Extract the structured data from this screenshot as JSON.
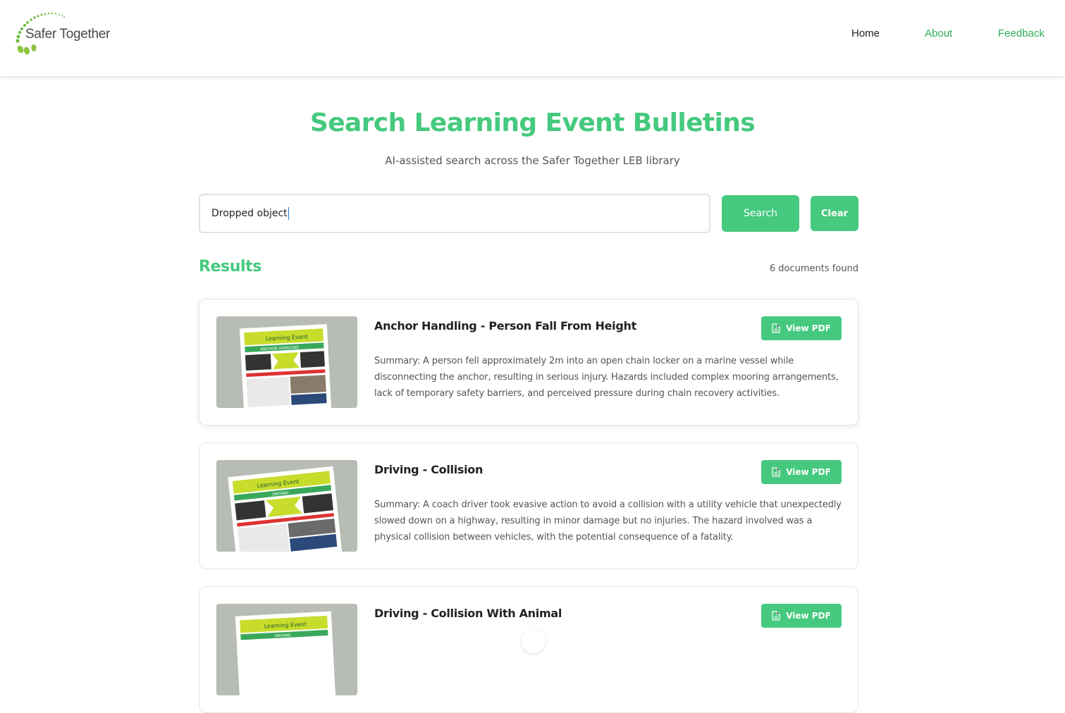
{
  "header": {
    "logo_text": "Safer Together",
    "nav": [
      {
        "label": "Home"
      },
      {
        "label": "About"
      },
      {
        "label": "Feedback"
      }
    ]
  },
  "hero": {
    "title": "Search Learning Event Bulletins",
    "subtitle": "AI-assisted search across the Safer Together LEB library"
  },
  "search": {
    "value": "Dropped object",
    "search_label": "Search",
    "clear_label": "Clear"
  },
  "results": {
    "title": "Results",
    "count_text": "6 documents found",
    "items": [
      {
        "title": "Anchor Handling - Person Fall From Height",
        "summary": "Summary: A person fell approximately 2m into an open chain locker on a marine vessel while disconnecting the anchor, resulting in serious injury. Hazards included complex mooring arrangements, lack of temporary safety barriers, and perceived pressure during chain recovery activities.",
        "button_label": "View PDF",
        "thumb": {
          "heading": "Learning Event",
          "banner": "ANCHOR HANDLING"
        }
      },
      {
        "title": "Driving - Collision",
        "summary": "Summary: A coach driver took evasive action to avoid a collision with a utility vehicle that unexpectedly slowed down on a highway, resulting in minor damage but no injuries. The hazard involved was a physical collision between vehicles, with the potential consequence of a fatality.",
        "button_label": "View PDF",
        "thumb": {
          "heading": "Learning Event",
          "banner": "DRIVING"
        }
      },
      {
        "title": "Driving - Collision With Animal",
        "summary": "",
        "button_label": "View PDF",
        "thumb": {
          "heading": "Learning Event",
          "banner": "DRIVING"
        }
      }
    ]
  },
  "colors": {
    "accent": "#45c97e",
    "nav_green": "#2eae5a",
    "thumb_yellow": "#c8dc2c",
    "thumb_green": "#3aa85a"
  }
}
